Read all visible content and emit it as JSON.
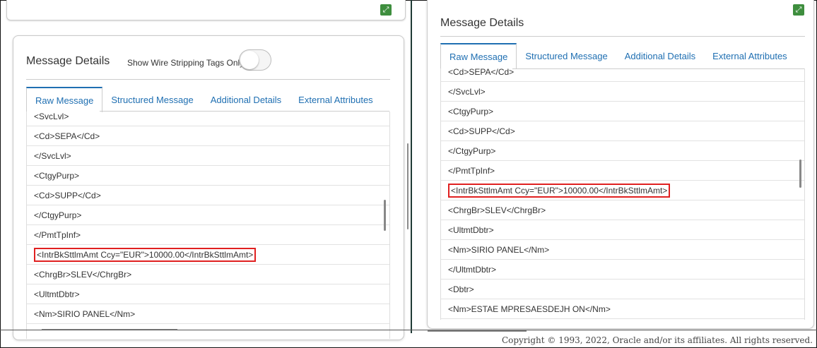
{
  "left_panel": {
    "title": "Message Details",
    "toggle_label": "Show Wire Stripping Tags Only",
    "tabs": [
      "Raw Message",
      "Structured Message",
      "Additional Details",
      "External Attributes"
    ],
    "rows": [
      "<SvcLvl>",
      "<Cd>SEPA</Cd>",
      "</SvcLvl>",
      "<CtgyPurp>",
      "<Cd>SUPP</Cd>",
      "</CtgyPurp>",
      "</PmtTpInf>",
      "<IntrBkSttlmAmt Ccy=\"EUR\">10000.00</IntrBkSttlmAmt>",
      "<ChrgBr>SLEV</ChrgBr>",
      "<UltmtDbtr>",
      "<Nm>SIRIO PANEL</Nm>"
    ],
    "highlighted_row_index": 7
  },
  "right_panel": {
    "title": "Message Details",
    "tabs": [
      "Raw Message",
      "Structured Message",
      "Additional Details",
      "External Attributes"
    ],
    "rows": [
      "<Cd>SEPA</Cd>",
      "</SvcLvl>",
      "<CtgyPurp>",
      "<Cd>SUPP</Cd>",
      "</CtgyPurp>",
      "</PmtTpInf>",
      "<IntrBkSttlmAmt Ccy=\"EUR\">10000.00</IntrBkSttlmAmt>",
      "<ChrgBr>SLEV</ChrgBr>",
      "<UltmtDbtr>",
      "<Nm>SIRIO PANEL</Nm>",
      "</UltmtDbtr>",
      "<Dbtr>",
      "<Nm>ESTAE MPRESAESDEJH ON</Nm>"
    ],
    "highlighted_row_index": 6
  },
  "footer": {
    "copyright": "Copyright © 1993, 2022, Oracle and/or its affiliates. All rights reserved."
  },
  "icons": {
    "expand": "expand-icon"
  },
  "colors": {
    "tab_link": "#1f6fb2",
    "highlight_border": "#e02020",
    "expand_button": "#3e8e3e"
  }
}
